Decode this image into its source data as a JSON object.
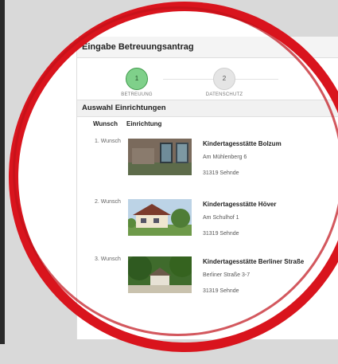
{
  "panel_title": "Eingabe Betreuungsantrag",
  "steps": [
    {
      "number": "1",
      "label": "BETREUUNG",
      "active": true
    },
    {
      "number": "2",
      "label": "DATENSCHUTZ",
      "active": false
    }
  ],
  "section_title": "Auswahl Einrichtungen",
  "columns": {
    "wish": "Wunsch",
    "facility": "Einrichtung"
  },
  "rows": [
    {
      "wish": "1. Wunsch",
      "name": "Kindertagesstätte Bolzum",
      "street": "Am Mühlenberg 6",
      "city": "31319 Sehnde"
    },
    {
      "wish": "2. Wunsch",
      "name": "Kindertagesstätte Höver",
      "street": "Am Schulhof 1",
      "city": "31319 Sehnde"
    },
    {
      "wish": "3. Wunsch",
      "name": "Kindertagesstätte Berliner Straße",
      "street": "Berliner Straße 3-7",
      "city": "31319 Sehnde"
    }
  ],
  "colors": {
    "ring": "#d9141d",
    "active_step": "#7fd08a",
    "background": "#d9d9d9"
  }
}
